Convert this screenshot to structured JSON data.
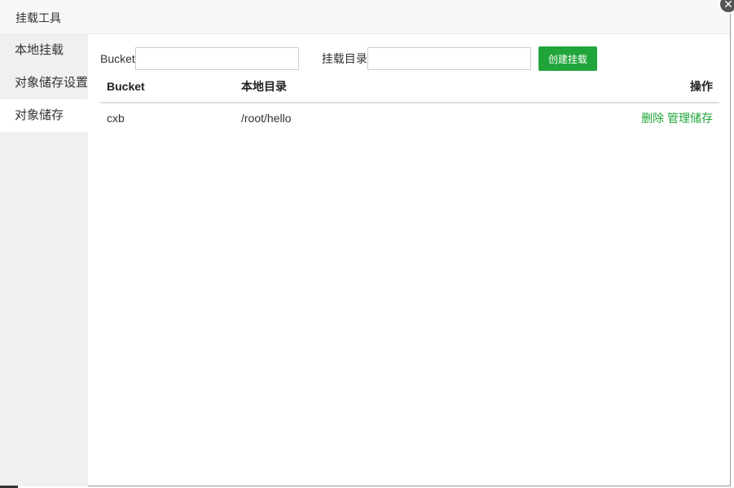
{
  "dialog": {
    "title": "挂载工具",
    "close_glyph": "✕"
  },
  "sidebar": {
    "items": [
      {
        "label": "本地挂载",
        "active": false
      },
      {
        "label": "对象储存设置",
        "active": false
      },
      {
        "label": "对象储存",
        "active": true
      }
    ]
  },
  "form": {
    "bucket_label": "Bucket",
    "bucket_value": "",
    "mount_dir_label": "挂载目录",
    "mount_dir_value": "",
    "create_button": "创建挂载"
  },
  "table": {
    "headers": [
      "Bucket",
      "本地目录",
      "操作"
    ],
    "rows": [
      {
        "bucket": "cxb",
        "local_dir": "/root/hello",
        "actions": [
          "删除",
          "管理储存"
        ]
      }
    ]
  },
  "colors": {
    "accent": "#20a53a",
    "sidebar_bg": "#f0f0f0",
    "titlebar_bg": "#f8f8f8"
  }
}
